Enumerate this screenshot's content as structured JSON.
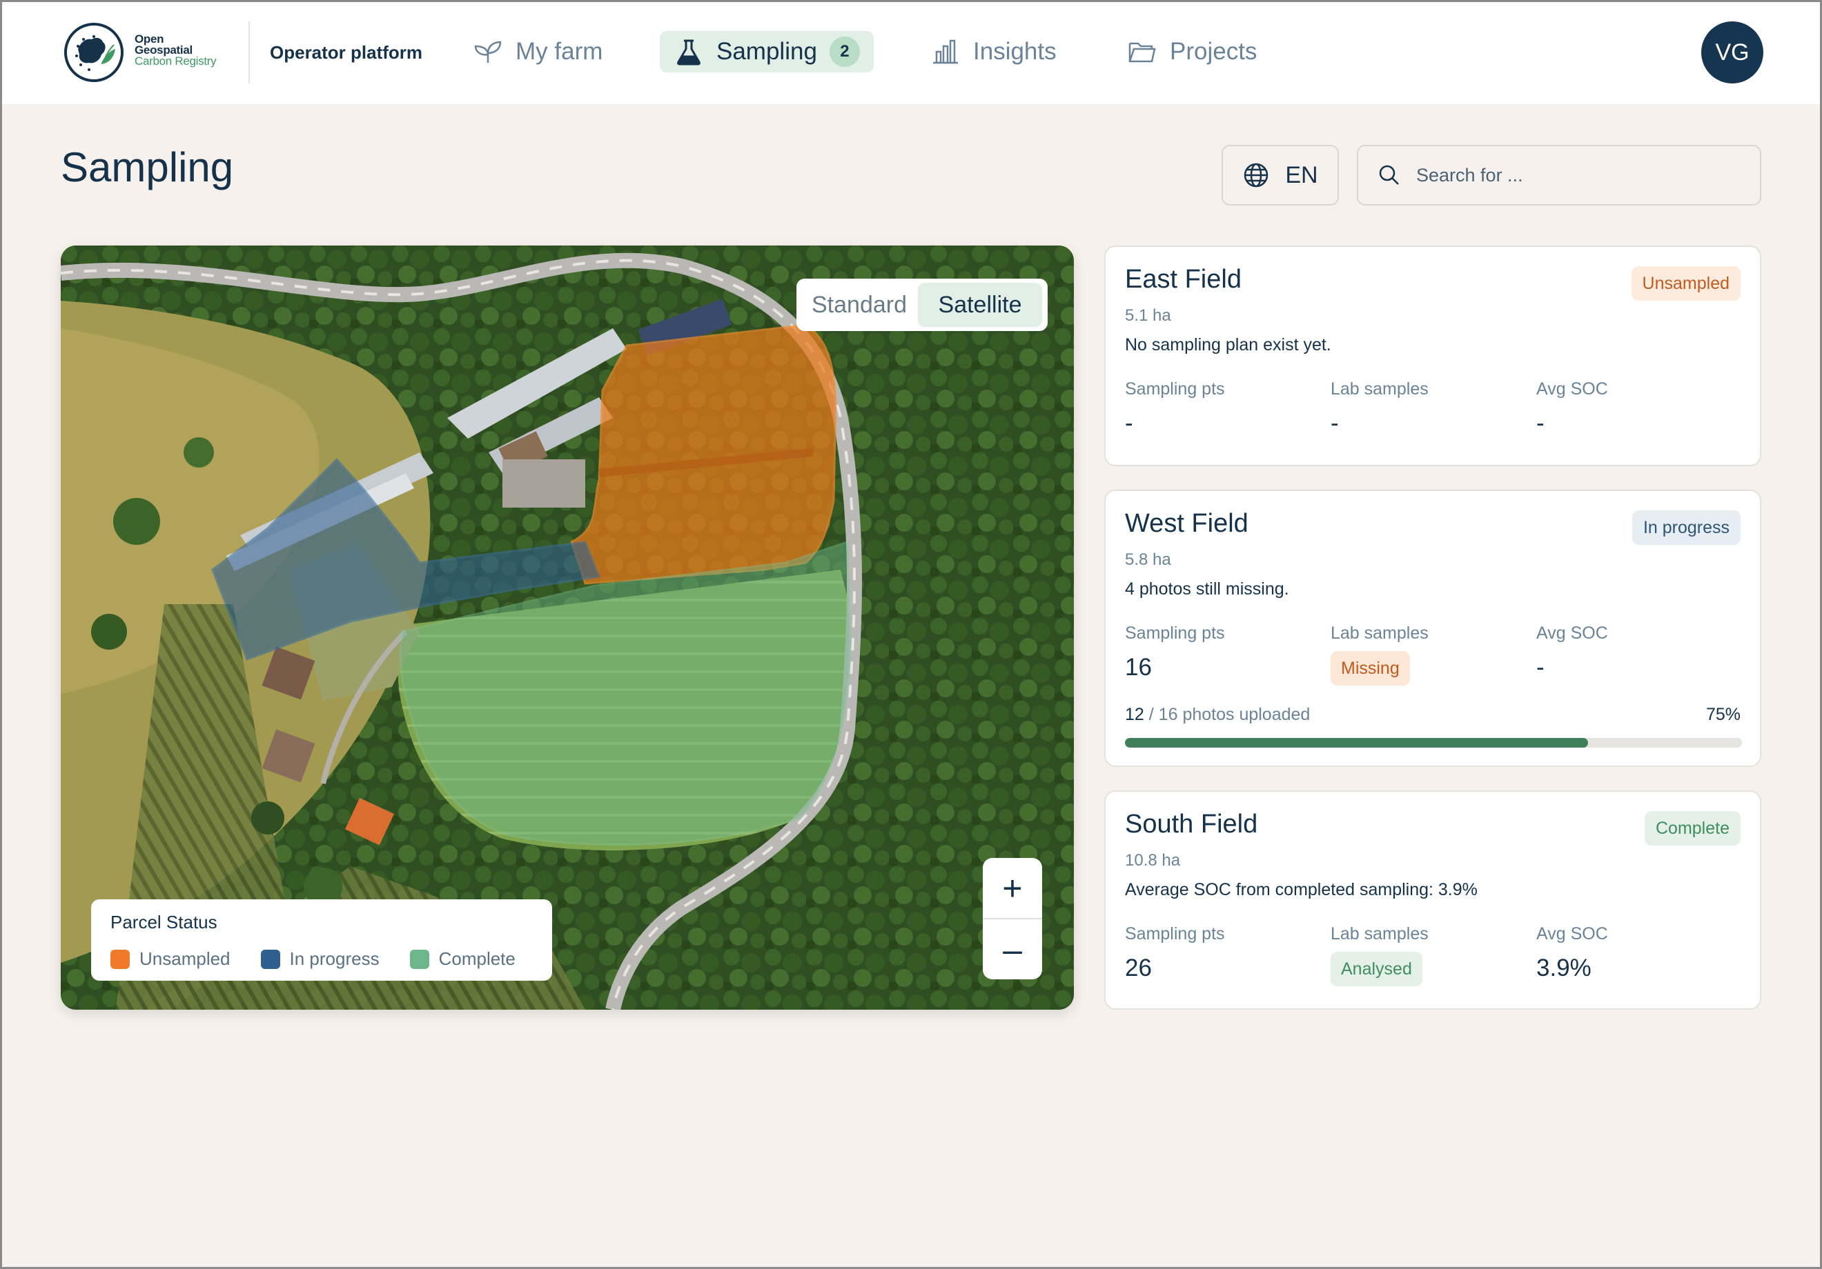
{
  "header": {
    "logo": {
      "line1": "Open",
      "line2": "Geospatial",
      "line3": "Carbon Registry"
    },
    "platform_label": "Operator platform",
    "nav": [
      {
        "label": "My farm",
        "icon": "sprout-icon"
      },
      {
        "label": "Sampling",
        "icon": "flask-icon",
        "badge": "2",
        "active": true
      },
      {
        "label": "Insights",
        "icon": "bar-chart-icon"
      },
      {
        "label": "Projects",
        "icon": "folder-icon"
      }
    ],
    "avatar_initials": "VG"
  },
  "page": {
    "title": "Sampling",
    "language": "EN",
    "search_placeholder": "Search for ..."
  },
  "map": {
    "toggle": {
      "standard": "Standard",
      "satellite": "Satellite",
      "selected": "satellite"
    },
    "zoom_in": "+",
    "zoom_out": "–",
    "legend": {
      "title": "Parcel Status",
      "items": [
        {
          "label": "Unsampled",
          "color": "#f07a2a"
        },
        {
          "label": "In progress",
          "color": "#2f5f8f"
        },
        {
          "label": "Complete",
          "color": "#6db88a"
        }
      ]
    }
  },
  "stat_labels": {
    "points": "Sampling pts",
    "lab": "Lab samples",
    "soc": "Avg SOC"
  },
  "fields": [
    {
      "name": "East Field",
      "area": "5.1 ha",
      "status": "Unsampled",
      "note": "No sampling plan exist yet.",
      "points": "-",
      "lab": "-",
      "soc": "-"
    },
    {
      "name": "West Field",
      "area": "5.8 ha",
      "status": "In progress",
      "note": "4 photos still missing.",
      "points": "16",
      "lab": "Missing",
      "soc": "-",
      "photos_uploaded": "12",
      "photos_total": "16",
      "photos_suffix": "photos uploaded",
      "progress_percent": 75,
      "progress_label": "75%"
    },
    {
      "name": "South Field",
      "area": "10.8 ha",
      "status": "Complete",
      "note": "Average SOC from completed sampling: 3.9%",
      "points": "26",
      "lab": "Analysed",
      "soc": "3.9%"
    }
  ]
}
